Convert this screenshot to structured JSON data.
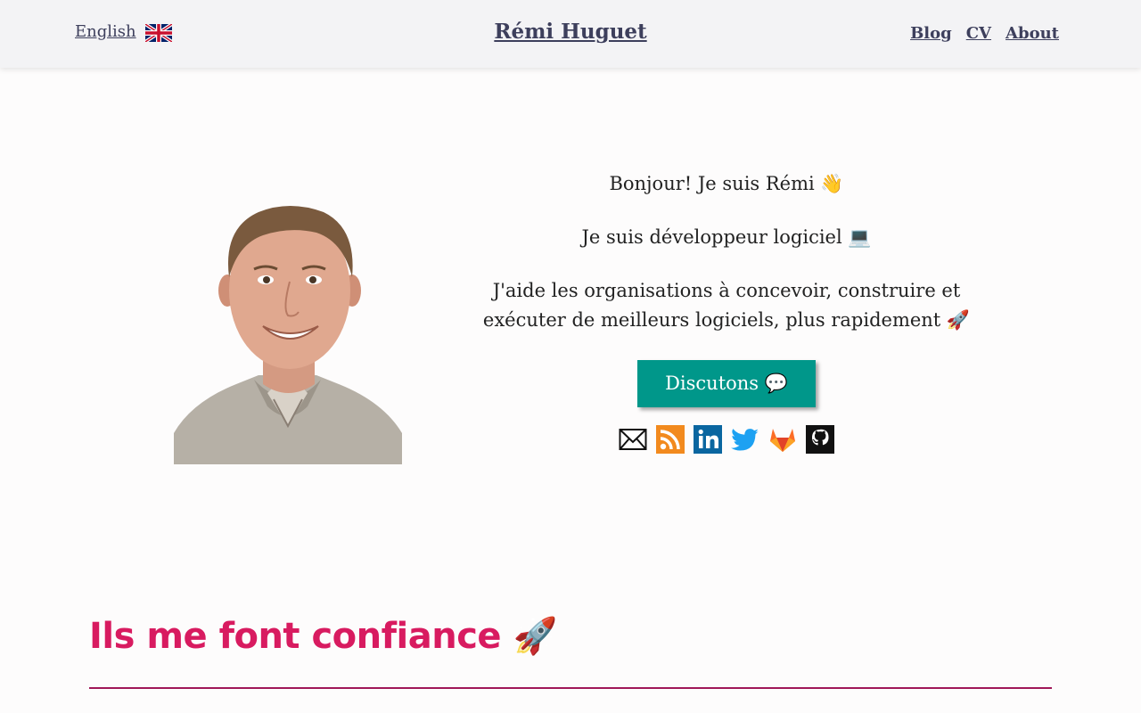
{
  "header": {
    "language_label": "English",
    "language_flag_icon": "uk-flag-icon",
    "site_title": "Rémi Huguet",
    "nav": [
      "Blog",
      "CV",
      "About"
    ]
  },
  "hero": {
    "greeting": "Bonjour! Je suis Rémi 👋",
    "role": "Je suis développeur logiciel 💻",
    "pitch": "J'aide les organisations à concevoir, construire et exécuter de meilleurs logiciels, plus rapidement 🚀",
    "cta_label": "Discutons 💬",
    "social_icons": [
      "email-icon",
      "rss-icon",
      "linkedin-icon",
      "twitter-icon",
      "gitlab-icon",
      "github-icon"
    ]
  },
  "section": {
    "title": "Ils me font confiance 🚀"
  },
  "colors": {
    "header_bg": "#f3f3f5",
    "link": "#3d3f5c",
    "cta_bg": "#00978a",
    "section_title": "#d81b60",
    "divider": "#a01758"
  }
}
